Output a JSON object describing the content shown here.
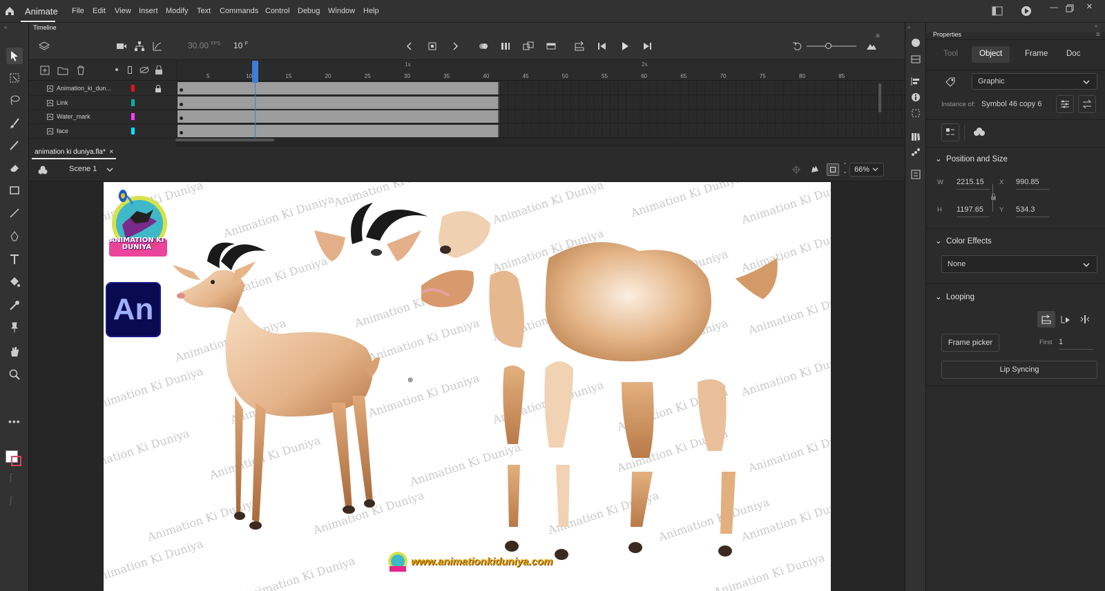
{
  "app": {
    "name": "Animate"
  },
  "menu": [
    "File",
    "Edit",
    "View",
    "Insert",
    "Modify",
    "Text",
    "Commands",
    "Control",
    "Debug",
    "Window",
    "Help"
  ],
  "timeline": {
    "title": "Timeline",
    "fps": "30.00",
    "fps_unit": "FPS",
    "frame": "10",
    "frame_unit": "F",
    "ruler_labels": [
      "5",
      "10",
      "15",
      "20",
      "25",
      "30",
      "35",
      "40",
      "45",
      "50",
      "55",
      "60",
      "65",
      "70",
      "75",
      "80",
      "85"
    ],
    "sec1": "1s",
    "sec2": "2s",
    "layers": [
      {
        "name": "Animation_ki_dun...",
        "color": "#e81123",
        "locked": true
      },
      {
        "name": "Link",
        "color": "#00b3a4",
        "locked": false
      },
      {
        "name": "Water_mark",
        "color": "#ff40ff",
        "locked": false
      },
      {
        "name": "face",
        "color": "#00e5ff",
        "locked": false
      }
    ]
  },
  "document": {
    "tab": "animation ki duniya.fla*",
    "close": "×",
    "scene": "Scene 1",
    "zoom": "66%"
  },
  "stage": {
    "watermark": "Animation Ki Duniya",
    "logo_text": "ANIMATION KI DUNIYA",
    "an_badge": "An",
    "url": "www.animationkiduniya.com"
  },
  "properties": {
    "title": "Properties",
    "tabs": [
      "Tool",
      "Object",
      "Frame",
      "Doc"
    ],
    "active_tab": "Object",
    "instance_type": "Graphic",
    "instance_of_label": "Instance of:",
    "instance_of": "Symbol 46 copy 6",
    "position_size": {
      "title": "Position and Size",
      "w_label": "W",
      "w": "2215.15",
      "x_label": "X",
      "x": "990.85",
      "h_label": "H",
      "h": "1197.65",
      "y_label": "Y",
      "y": "534.3"
    },
    "color_effects": {
      "title": "Color Effects",
      "value": "None"
    },
    "looping": {
      "title": "Looping",
      "frame_picker": "Frame picker",
      "first_label": "First",
      "first": "1",
      "lip_sync": "Lip Syncing"
    }
  },
  "colors": {
    "accent": "#3c7ed8",
    "panel": "#2b2b2b",
    "stage": "#ffffff"
  }
}
